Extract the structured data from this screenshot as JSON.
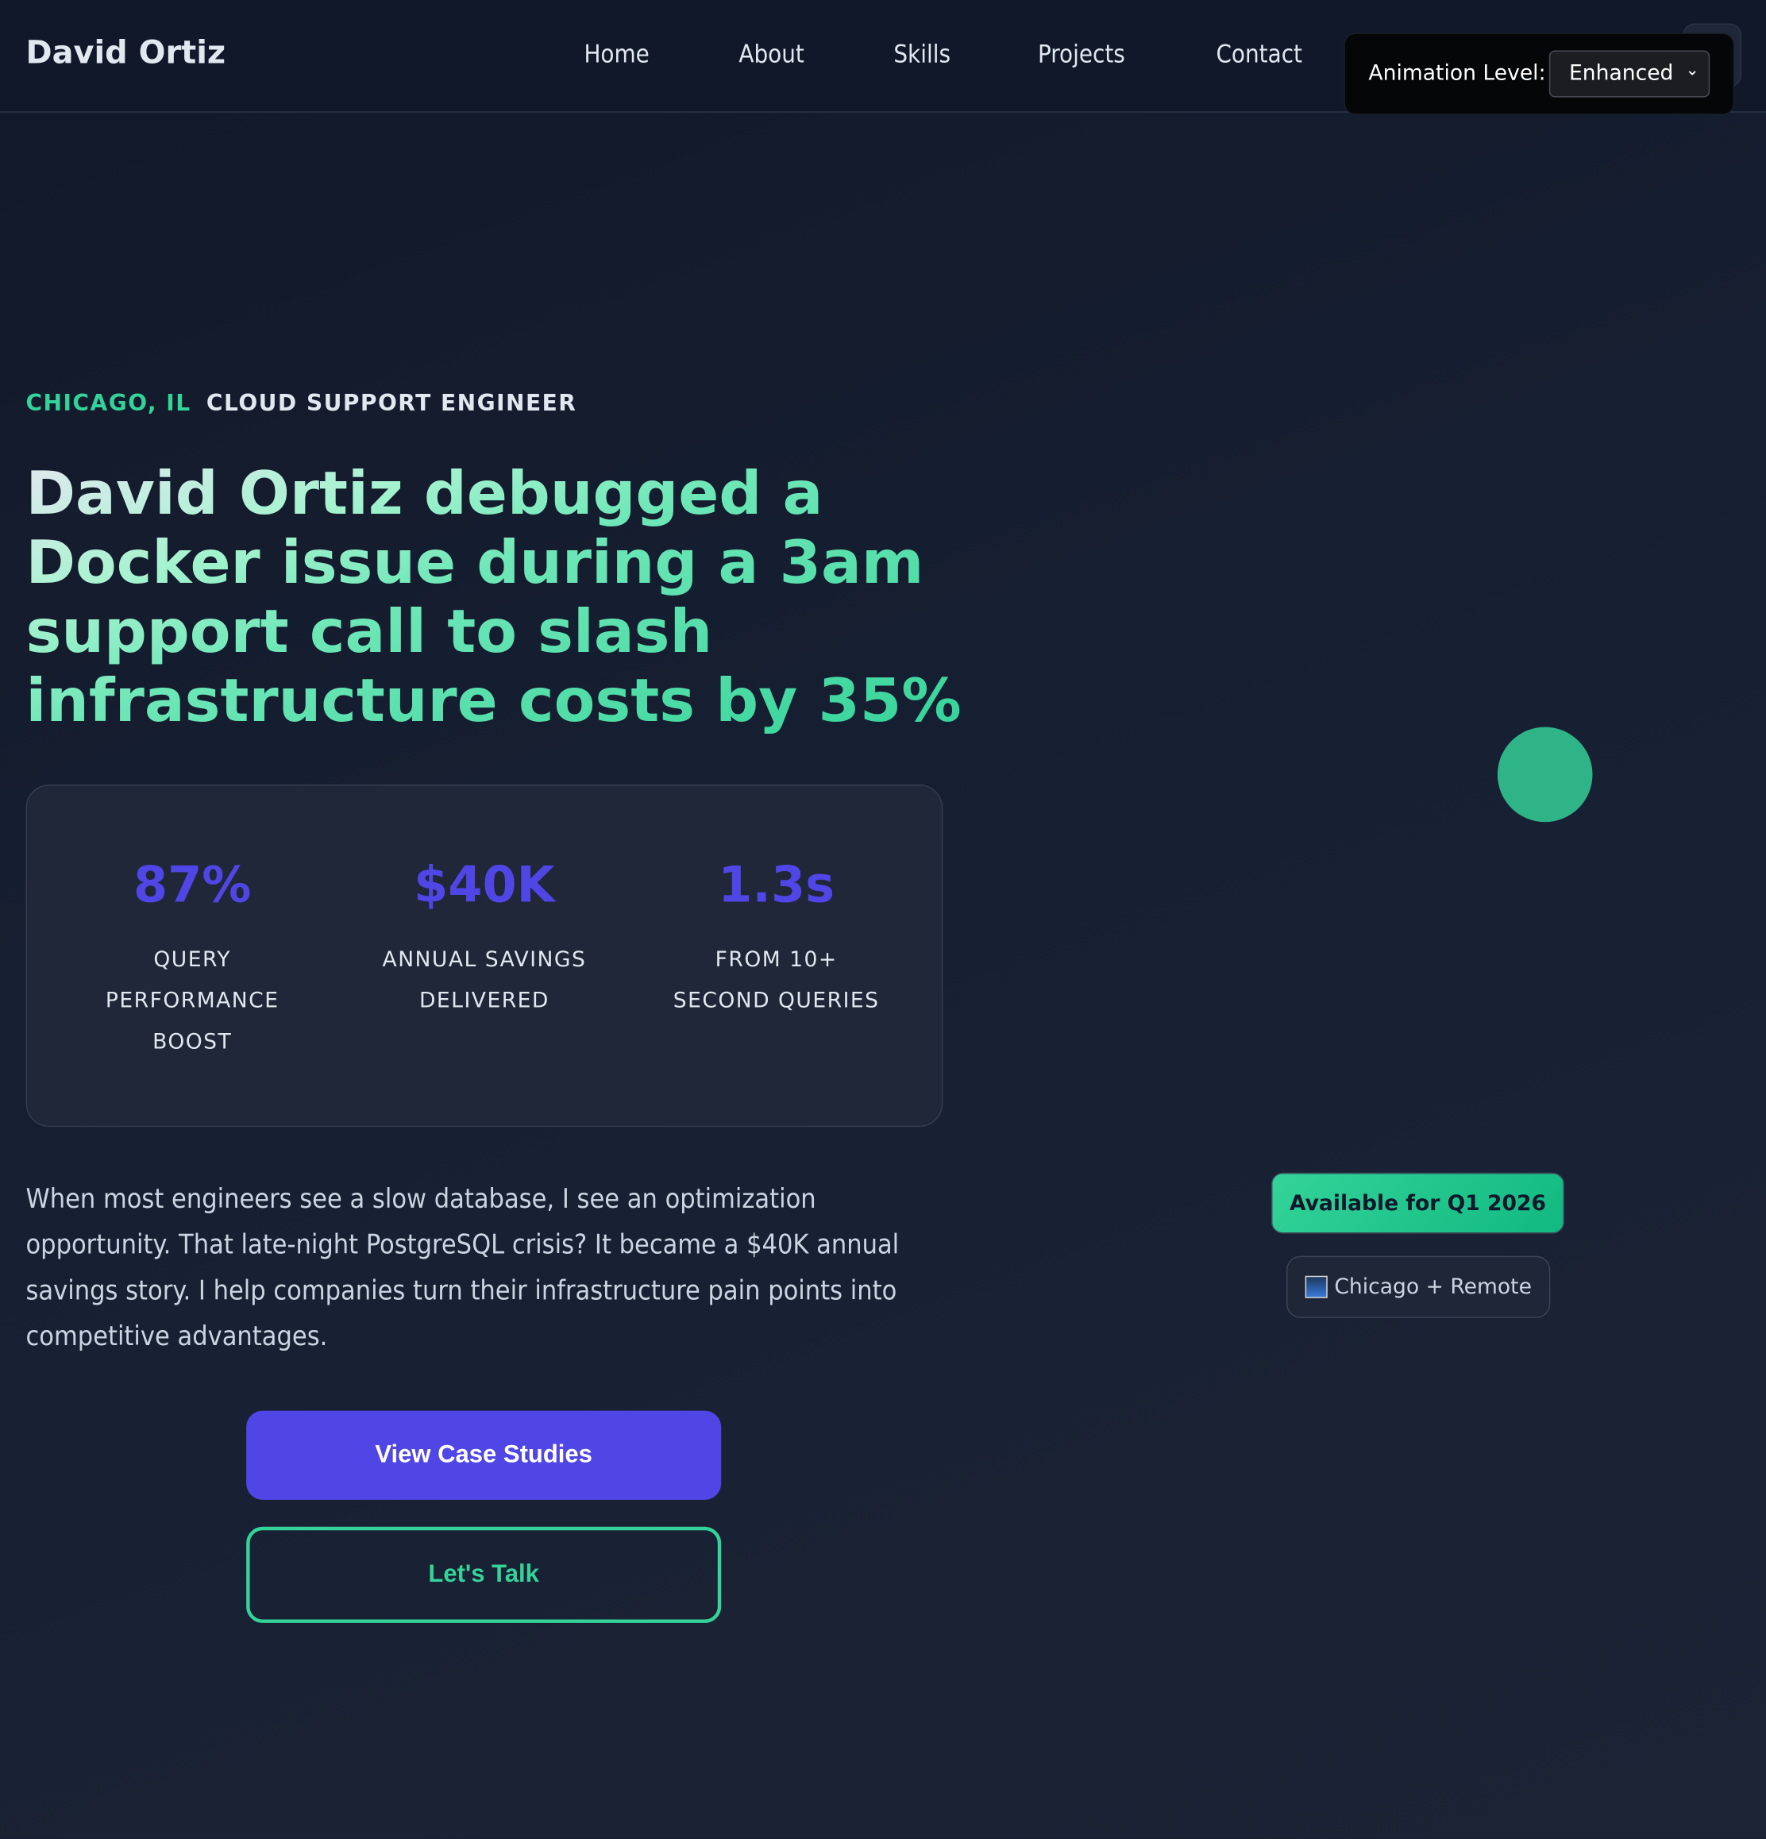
{
  "nav": {
    "logo": "David Ortiz",
    "links": [
      "Home",
      "About",
      "Skills",
      "Projects",
      "Contact"
    ],
    "animation_label": "Animation Level:",
    "animation_value": "Enhanced"
  },
  "hero": {
    "location": "CHICAGO, IL",
    "role": "CLOUD SUPPORT ENGINEER",
    "headline": "David Ortiz debugged a Docker issue during a 3am support call to slash infrastructure costs by 35%",
    "stats": [
      {
        "value": "87%",
        "label": "QUERY PERFORMANCE BOOST"
      },
      {
        "value": "$40K",
        "label": "ANNUAL SAVINGS DELIVERED"
      },
      {
        "value": "1.3s",
        "label": "FROM 10+ SECOND QUERIES"
      }
    ],
    "intro": "When most engineers see a slow database, I see an optimization opportunity. That late-night PostgreSQL crisis? It became a $40K annual savings story. I help companies turn their infrastructure pain points into competitive advantages.",
    "primary_cta": "View Case Studies",
    "secondary_cta": "Let's Talk"
  },
  "side": {
    "availability": "Available for Q1 2026",
    "location_badge": "Chicago + Remote",
    "location_icon": "night-city-icon"
  },
  "colors": {
    "accent": "#4f46e5",
    "green": "#34d399",
    "bg": "#111829"
  }
}
